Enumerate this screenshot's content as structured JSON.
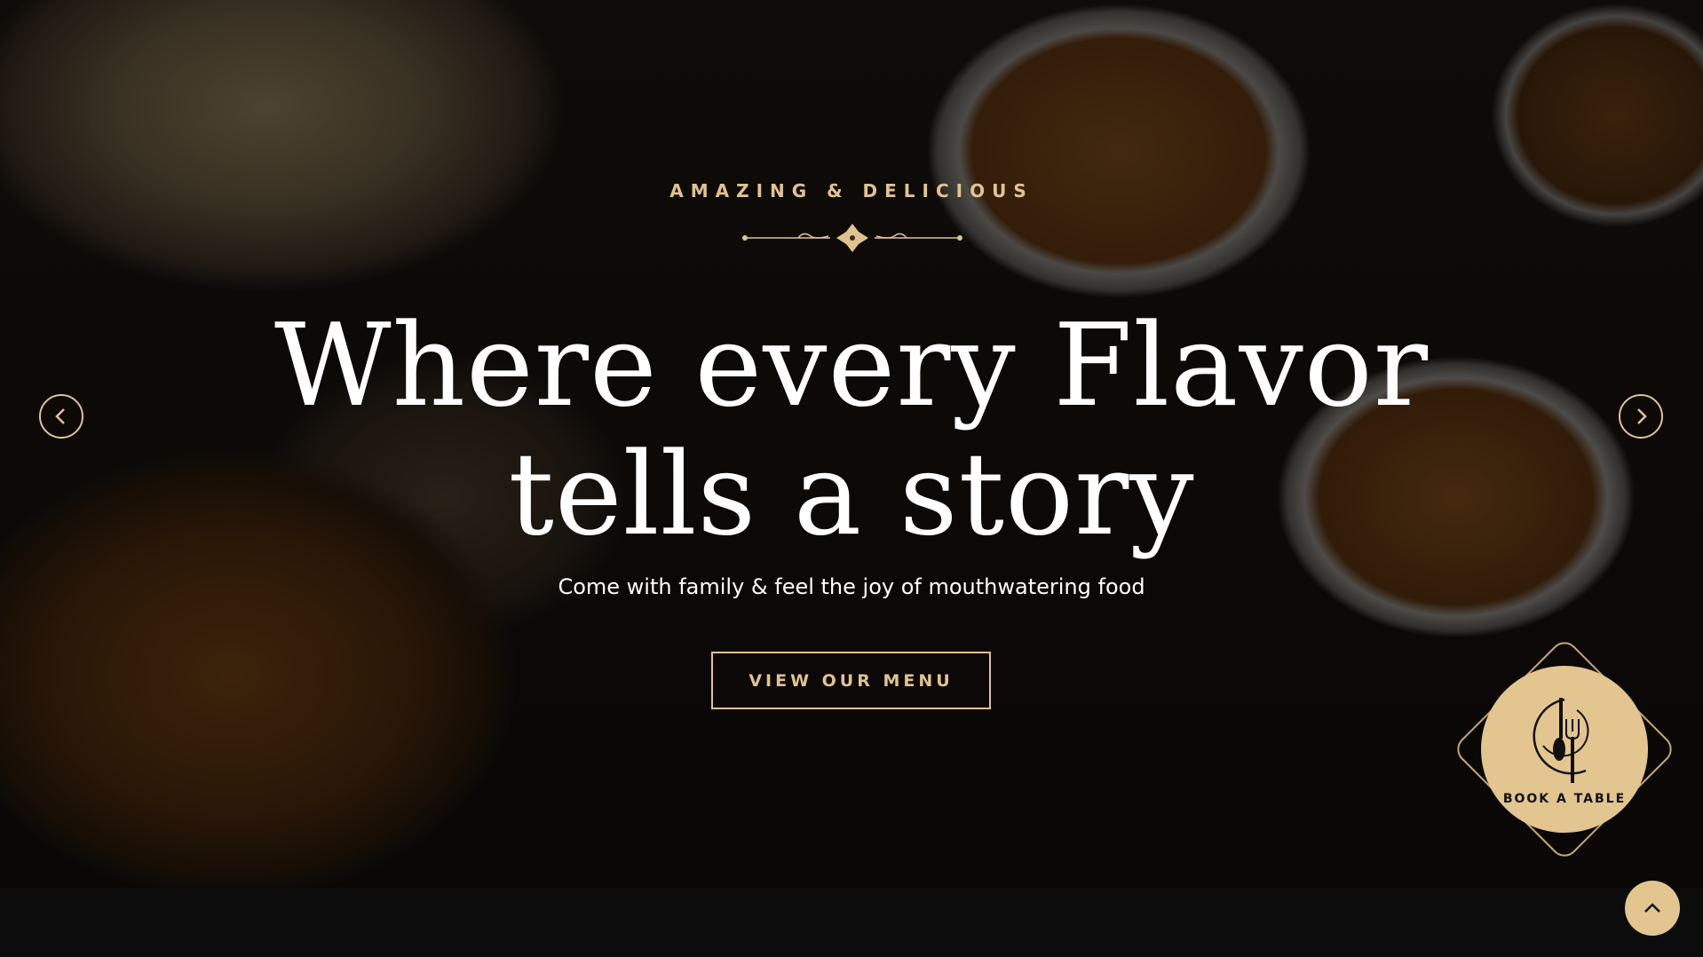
{
  "hero": {
    "kicker": "AMAZING & DELICIOUS",
    "headline_line1": "Where every Flavor",
    "headline_line2": "tells a story",
    "subtitle": "Come with family & feel the joy of mouthwatering food",
    "cta_label": "VIEW OUR MENU"
  },
  "carousel": {
    "prev_icon": "chevron-left-icon",
    "next_icon": "chevron-right-icon"
  },
  "book_table": {
    "label": "BOOK A TABLE",
    "icon": "plate-fork-spoon-icon"
  },
  "scroll_top": {
    "icon": "chevron-up-icon"
  },
  "colors": {
    "accent": "#e2c38e",
    "background": "#0c0c0c"
  }
}
